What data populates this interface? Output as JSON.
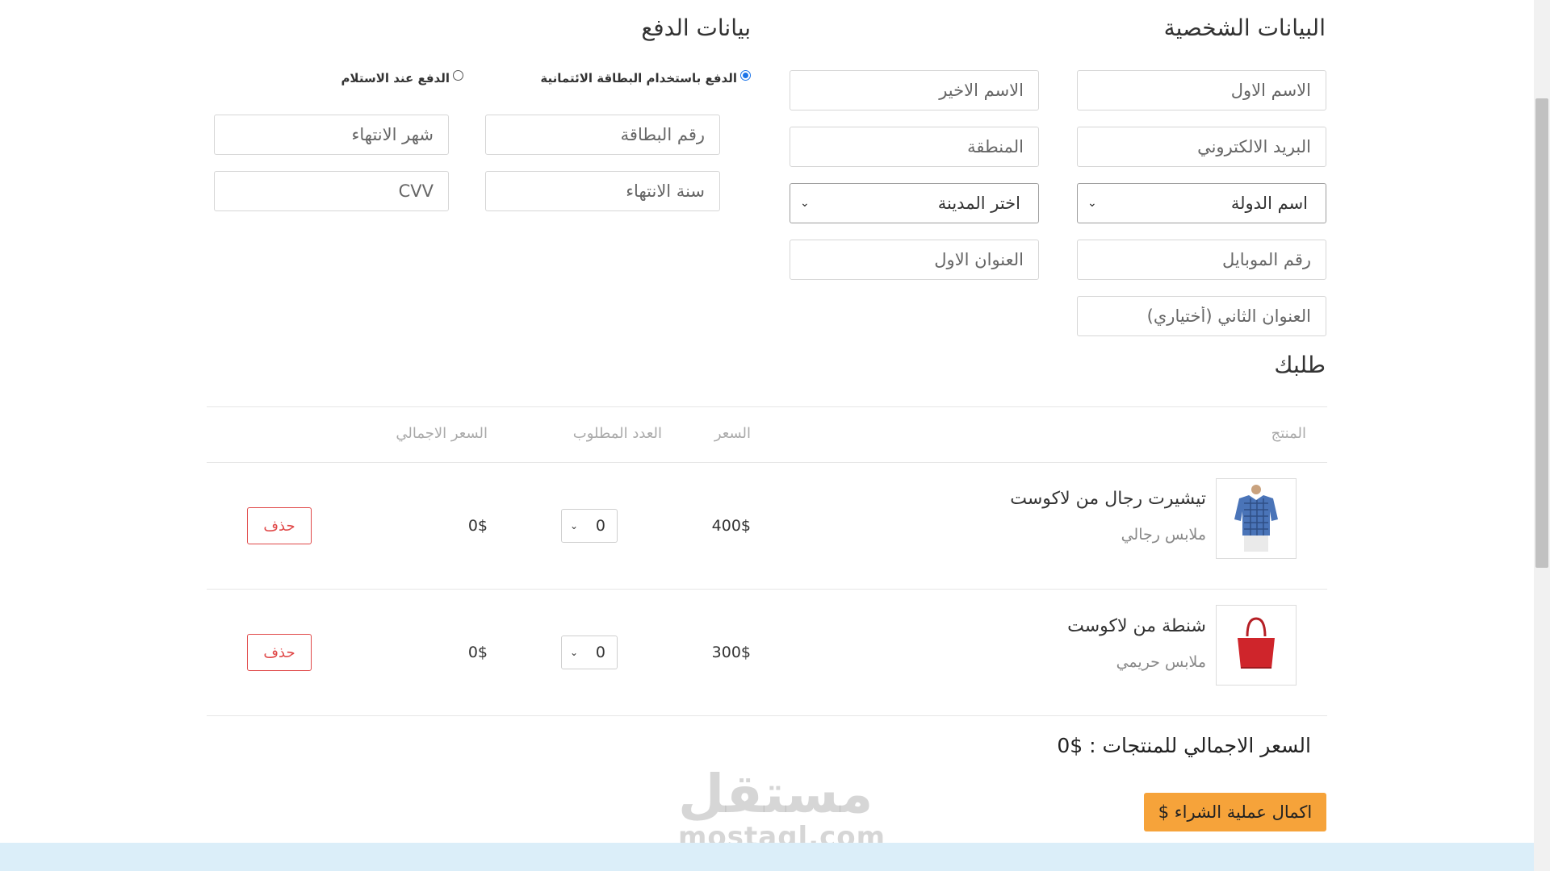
{
  "personal": {
    "title": "البيانات الشخصية",
    "first_name_placeholder": "الاسم الاول",
    "last_name_placeholder": "الاسم الاخير",
    "email_placeholder": "البريد الالكتروني",
    "region_placeholder": "المنطقة",
    "country_select": "اسم الدولة",
    "city_select": "اختر المدينة",
    "mobile_placeholder": "رقم الموبايل",
    "address1_placeholder": "العنوان الاول",
    "address2_placeholder": "العنوان الثاني (أختياري)"
  },
  "payment": {
    "title": "بيانات الدفع",
    "option_card": "الدفع باستخدام البطاقة الائتمانية",
    "option_cod": "الدفع عند الاستلام",
    "selected_option": "option_card",
    "card_number_placeholder": "رقم البطاقة",
    "expiry_month_placeholder": "شهر الانتهاء",
    "expiry_year_placeholder": "سنة الانتهاء",
    "cvv_placeholder": "CVV"
  },
  "order": {
    "title": "طلبك",
    "headers": {
      "product": "المنتج",
      "price": "السعر",
      "quantity": "العدد المطلوب",
      "total": "السعر الاجمالي"
    },
    "rows": [
      {
        "name": "تيشيرت رجال من لاكوست",
        "category": "ملابس رجالي",
        "price": "400$",
        "qty": "0",
        "total": "0$",
        "delete": "حذف",
        "image_icon": "shirt-icon"
      },
      {
        "name": "شنطة من لاكوست",
        "category": "ملابس حريمي",
        "price": "300$",
        "qty": "0",
        "total": "0$",
        "delete": "حذف",
        "image_icon": "handbag-icon"
      }
    ],
    "grand_total": "السعر الاجمالي للمنتجات : $0",
    "checkout_label": "اكمال عملية الشراء $"
  },
  "watermark": {
    "arabic": "مستقل",
    "latin": "mostaql.com"
  },
  "colors": {
    "accent": "#f6a33a",
    "danger": "#e04848",
    "radio": "#1a73e8",
    "footer": "#dbeef9"
  }
}
